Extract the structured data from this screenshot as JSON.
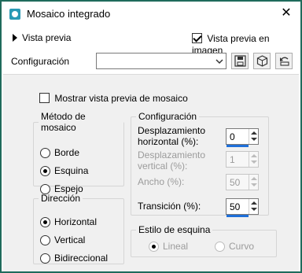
{
  "window": {
    "title": "Mosaico integrado",
    "close_glyph": "✕"
  },
  "preview": {
    "label": "Vista previa",
    "image_label": "Vista previa en imagen",
    "image_checked": true
  },
  "config_row": {
    "label": "Configuración",
    "selected_value": ""
  },
  "content": {
    "mosaic_preview_label": "Mostrar vista previa de mosaico",
    "mosaic_preview_checked": false,
    "metodo": {
      "legend": "Método de mosaico",
      "options": [
        "Borde",
        "Esquina",
        "Espejo"
      ],
      "selected": "Esquina"
    },
    "direccion": {
      "legend": "Dirección",
      "options": [
        "Horizontal",
        "Vertical",
        "Bidireccional"
      ],
      "selected": "Horizontal"
    },
    "configuracion": {
      "legend": "Configuración",
      "desp_horizontal_label": "Desplazamiento horizontal (%):",
      "desp_horizontal_value": "0",
      "desp_vertical_label": "Desplazamiento vertical (%):",
      "desp_vertical_value": "1",
      "ancho_label": "Ancho (%):",
      "ancho_value": "50",
      "transicion_label": "Transición (%):",
      "transicion_value": "50"
    },
    "estilo": {
      "legend": "Estilo de esquina",
      "options": [
        "Lineal",
        "Curvo"
      ],
      "selected": "Lineal"
    }
  },
  "colors": {
    "accent": "#1e6fd9",
    "window_border": "#1f6b5c",
    "app_icon": "#2a9ab5"
  }
}
